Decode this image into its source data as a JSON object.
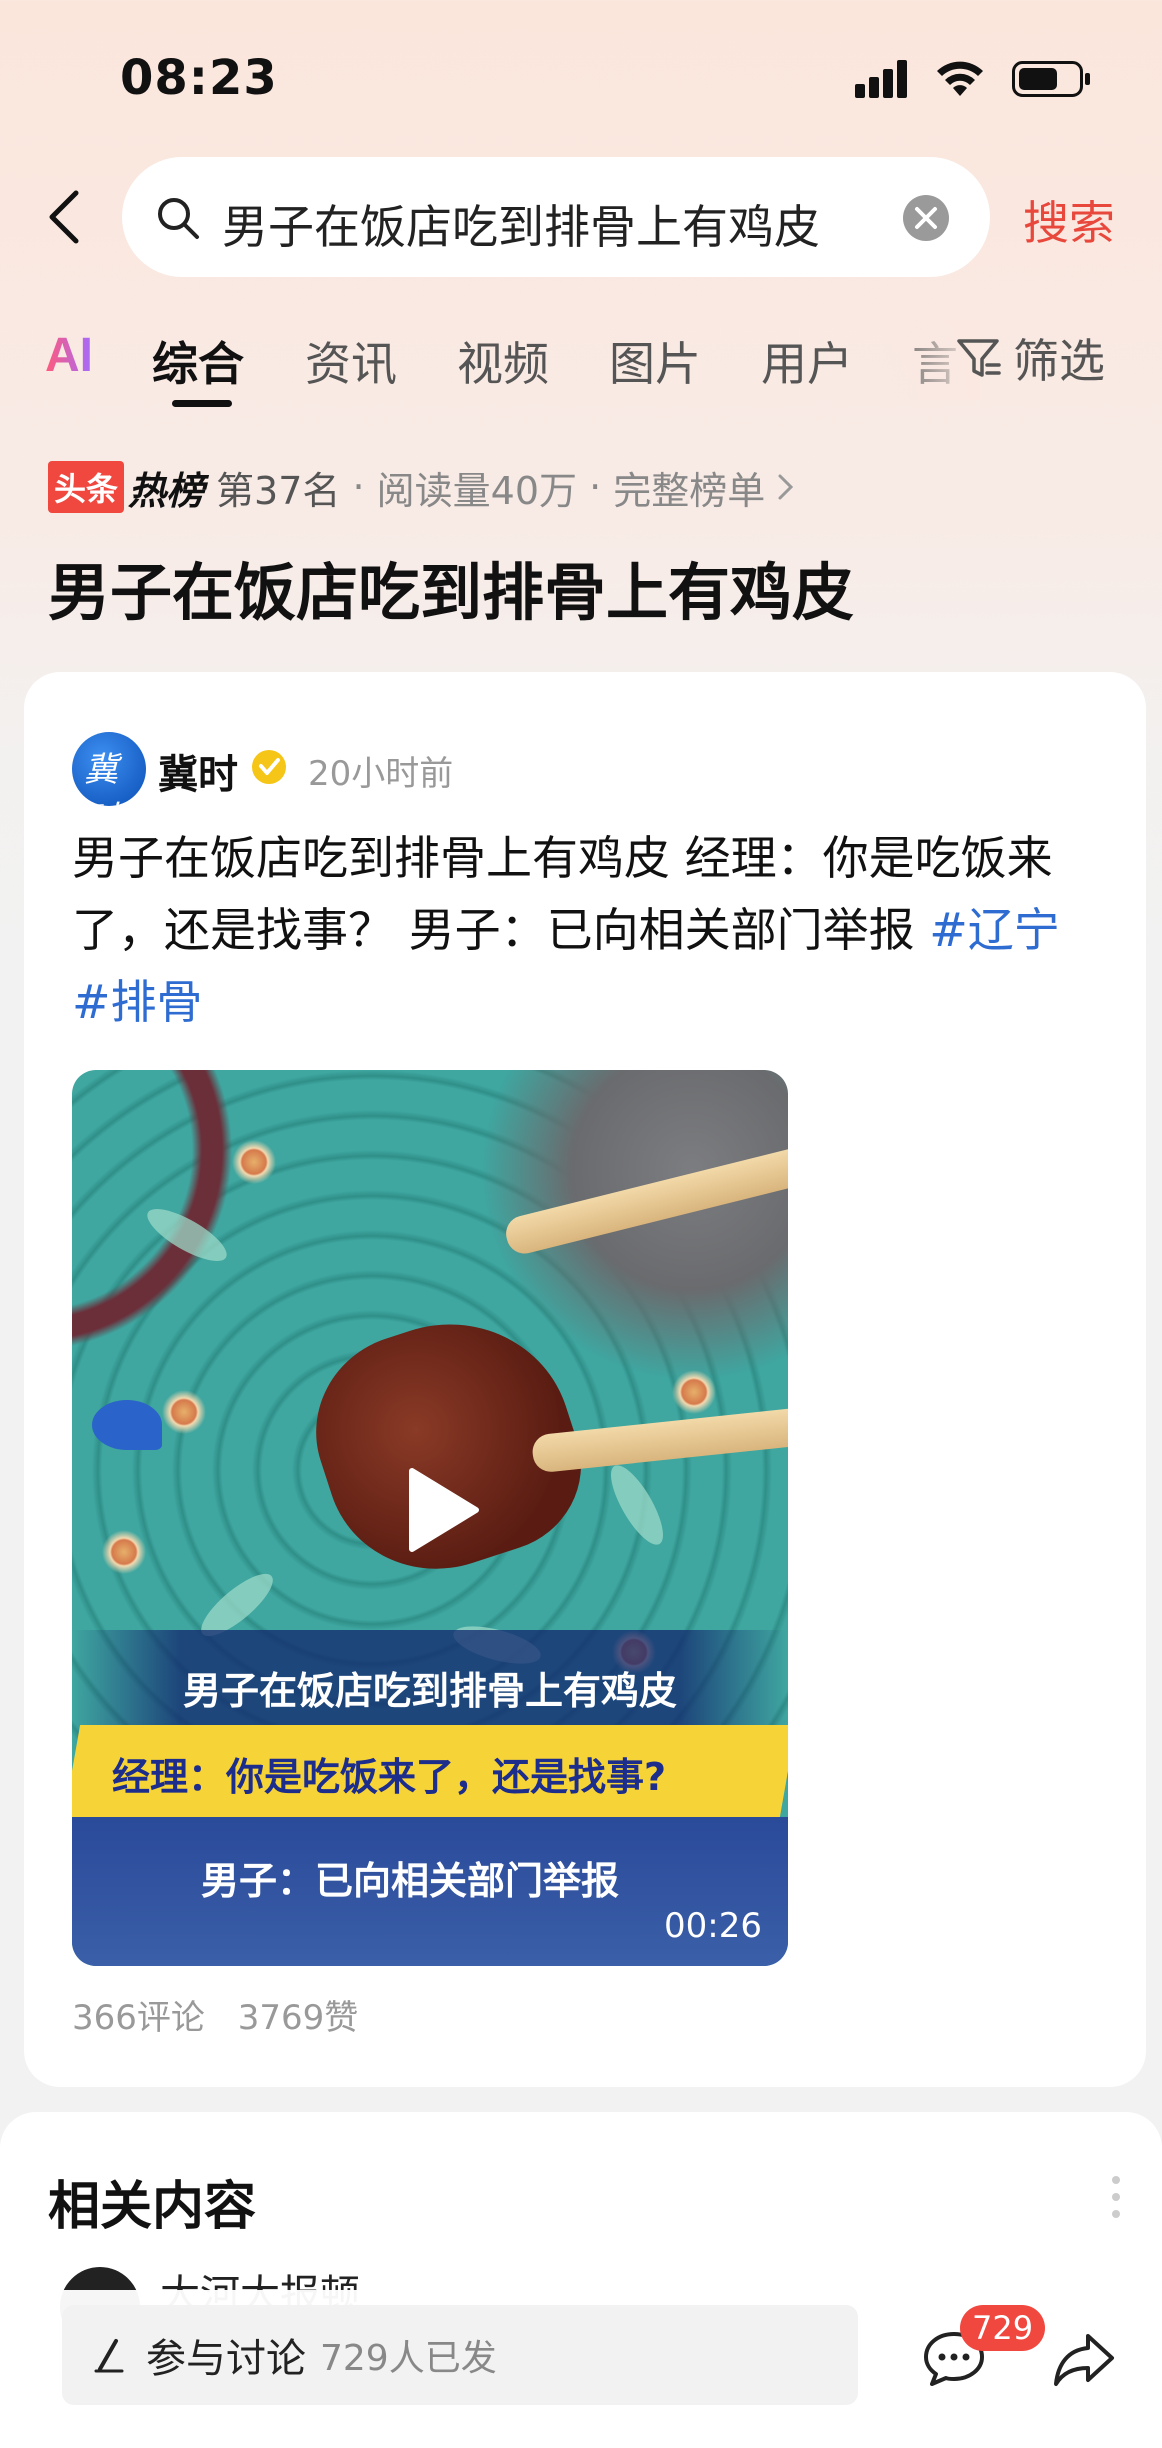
{
  "status_bar": {
    "time": "08:23"
  },
  "search": {
    "query": "男子在饭店吃到排骨上有鸡皮",
    "button_label": "搜索"
  },
  "tabs": {
    "ai_label": "AI",
    "items": [
      "综合",
      "资讯",
      "视频",
      "图片",
      "用户",
      "言"
    ],
    "active": "综合",
    "filter_label": "筛选"
  },
  "hotlist": {
    "tag": "头条",
    "word": "热榜",
    "rank": "第37名",
    "reads": "阅读量40万",
    "full_list": "完整榜单"
  },
  "topic_title": "男子在饭店吃到排骨上有鸡皮",
  "post": {
    "author": "冀时",
    "avatar_text": "冀时",
    "time": "20小时前",
    "text": "男子在饭店吃到排骨上有鸡皮 经理：你是吃饭来了，还是找事？ 男子：已向相关部门举报 ",
    "hashtags": [
      "#辽宁",
      "#排骨"
    ],
    "video": {
      "caption_line1": "男子在饭店吃到排骨上有鸡皮",
      "caption_line2": "经理：你是吃饭来了，还是找事?",
      "caption_line3": "男子：已向相关部门举报",
      "duration": "00:26"
    },
    "comments": "366评论",
    "likes": "3769赞"
  },
  "related": {
    "title": "相关内容",
    "partial_item": "大河大报顿"
  },
  "bottom_bar": {
    "discuss_label": "参与讨论",
    "discuss_count": "729人已发",
    "comment_badge": "729"
  },
  "colors": {
    "accent": "#e8473c",
    "hashtag": "#2f6cd1",
    "hot_tag": "#f0473f"
  }
}
